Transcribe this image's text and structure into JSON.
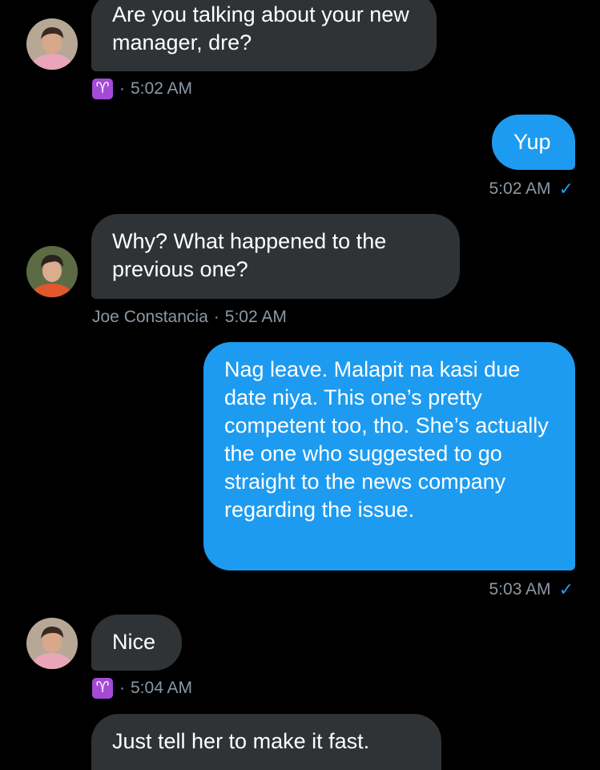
{
  "messages": [
    {
      "text": "Are you talking about your new manager, dre?",
      "meta_time": "5:02 AM"
    },
    {
      "text": "Yup",
      "meta_time": "5:02 AM"
    },
    {
      "text": "Why? What happened to the previous one?",
      "sender": "Joe Constancia",
      "meta_time": "5:02 AM"
    },
    {
      "text": "Nag leave. Malapit na kasi due date niya. This one’s pretty competent too, tho. She’s actually the one who suggested to go straight to the news company regarding the issue.",
      "meta_time": "5:03 AM"
    },
    {
      "text": "Nice",
      "meta_time": "5:04 AM"
    },
    {
      "text": "Just tell her to make it fast."
    }
  ],
  "zodiac_symbol": "♈",
  "separator": "·",
  "read_mark": "✓",
  "colors": {
    "background": "#000000",
    "incoming_bubble": "#2f3336",
    "outgoing_bubble": "#1d9bf0",
    "meta_text": "#8b98a5",
    "zodiac_badge": "#a44ad6"
  },
  "icons": [
    "avatar-pink-shirt",
    "avatar-orange-shirt",
    "aries-zodiac-icon",
    "read-check-icon"
  ]
}
